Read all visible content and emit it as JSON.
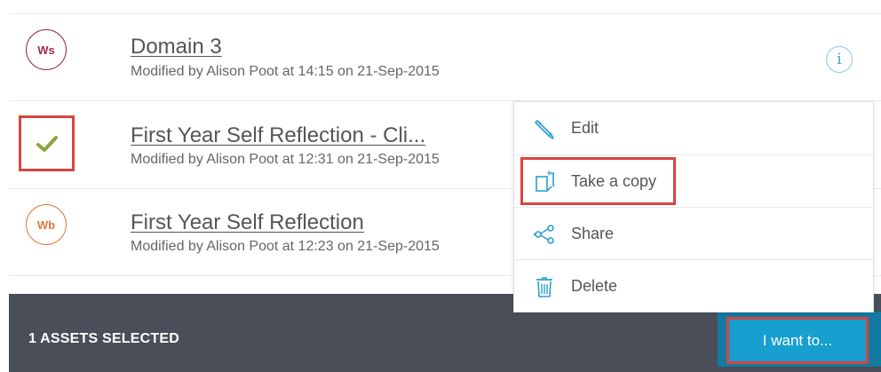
{
  "assets": [
    {
      "badge": "Ws",
      "badge_color": "#9b2a56",
      "title": "Domain 3",
      "meta": "Modified by Alison Poot at 14:15 on 21-Sep-2015"
    },
    {
      "badge": "",
      "badge_color": "#8aa63c",
      "title": "First Year Self Reflection - Cli...",
      "meta": "Modified by Alison Poot at 12:31 on 21-Sep-2015"
    },
    {
      "badge": "Wb",
      "badge_color": "#e07a3a",
      "title": "First Year Self Reflection",
      "meta": "Modified by Alison Poot at 12:23 on 21-Sep-2015"
    }
  ],
  "info_icon": "i",
  "menu": {
    "items": [
      {
        "label": "Edit",
        "icon": "pencil-icon"
      },
      {
        "label": "Take a copy",
        "icon": "copy-icon"
      },
      {
        "label": "Share",
        "icon": "share-icon"
      },
      {
        "label": "Delete",
        "icon": "trash-icon"
      }
    ]
  },
  "footer": {
    "selected_count": "1 ASSETS SELECTED",
    "action_button": "I want to..."
  },
  "colors": {
    "accent": "#169fcf",
    "highlight": "#d64541",
    "footer_bg": "#4a4e58"
  }
}
